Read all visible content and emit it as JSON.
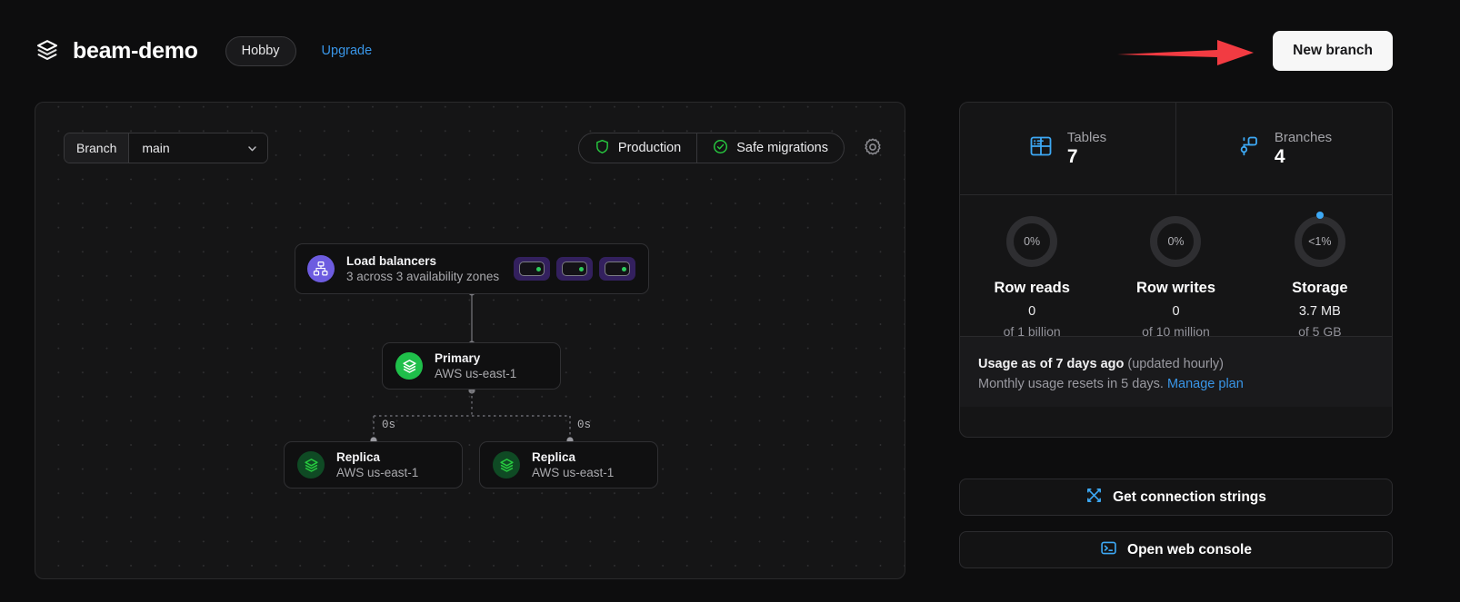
{
  "header": {
    "logo_icon": "layers-logo-icon",
    "title": "beam-demo",
    "plan_badge": "Hobby",
    "upgrade_label": "Upgrade",
    "new_branch_label": "New branch",
    "annotation": {
      "type": "red-arrow",
      "color": "#f23b42",
      "points_to": "New branch"
    }
  },
  "canvas": {
    "branch_selector": {
      "label": "Branch",
      "value": "main",
      "chevron_icon": "chevron-down-icon"
    },
    "status_chips": [
      {
        "label": "Production",
        "icon": "shield-icon",
        "color": "#27c93f"
      },
      {
        "label": "Safe migrations",
        "icon": "check-circle-icon",
        "color": "#27c93f"
      }
    ],
    "settings_icon": "gear-icon",
    "nodes": {
      "load_balancers": {
        "icon": "network-nodes-icon",
        "icon_color": "#6d5ce0",
        "title": "Load balancers",
        "subtitle": "3 across 3 availability zones",
        "chips": [
          {
            "status_color": "#2ecc5e"
          },
          {
            "status_color": "#2ecc5e"
          },
          {
            "status_color": "#2ecc5e"
          }
        ]
      },
      "primary": {
        "icon": "layers-logo-icon",
        "icon_color": "#1fbf4a",
        "title": "Primary",
        "subtitle": "AWS us-east-1"
      },
      "replicas": [
        {
          "icon": "layers-logo-icon",
          "icon_color": "#0f4a24",
          "title": "Replica",
          "subtitle": "AWS us-east-1",
          "latency": "0s"
        },
        {
          "icon": "layers-logo-icon",
          "icon_color": "#0f4a24",
          "title": "Replica",
          "subtitle": "AWS us-east-1",
          "latency": "0s"
        }
      ]
    }
  },
  "sidebar": {
    "counters": [
      {
        "icon": "table-icon",
        "icon_color": "#3da9f5",
        "label": "Tables",
        "value": "7"
      },
      {
        "icon": "branch-icon",
        "icon_color": "#3da9f5",
        "label": "Branches",
        "value": "4"
      }
    ],
    "usage": [
      {
        "percent_label": "0%",
        "percent": 0,
        "name": "Row reads",
        "amount": "0",
        "limit": "of 1 billion"
      },
      {
        "percent_label": "0%",
        "percent": 0,
        "name": "Row writes",
        "amount": "0",
        "limit": "of 10 million"
      },
      {
        "percent_label": "<1%",
        "percent": 1,
        "name": "Storage",
        "amount": "3.7 MB",
        "limit": "of 5 GB",
        "marker_color": "#3da9f5"
      }
    ],
    "usage_footer": {
      "line1_strong": "Usage as of 7 days ago",
      "line1_dim": "(updated hourly)",
      "line2_text": "Monthly usage resets in 5 days.",
      "line2_link": "Manage plan"
    },
    "actions": [
      {
        "icon": "connection-nodes-icon",
        "icon_color": "#3da9f5",
        "label": "Get connection strings"
      },
      {
        "icon": "terminal-icon",
        "icon_color": "#3da9f5",
        "label": "Open web console"
      }
    ]
  }
}
